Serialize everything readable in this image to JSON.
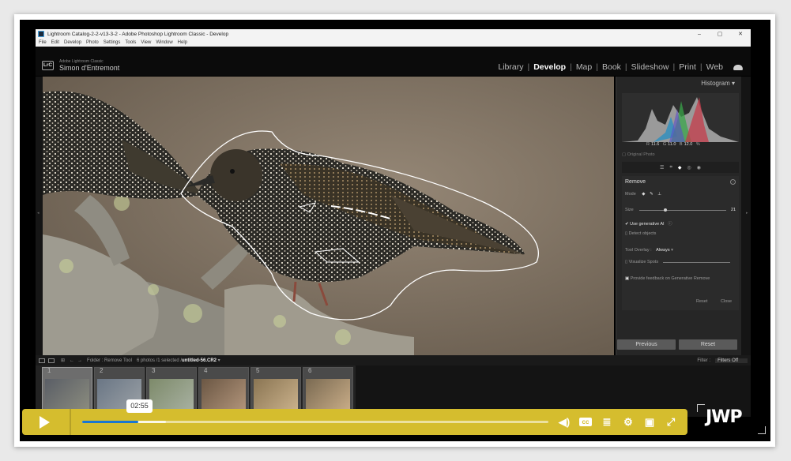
{
  "window": {
    "title": "Lightroom Catalog-2-2-v13-3-2 - Adobe Photoshop Lightroom Classic - Develop",
    "controls": [
      "–",
      "▢",
      "✕"
    ]
  },
  "menu": [
    "File",
    "Edit",
    "Develop",
    "Photo",
    "Settings",
    "Tools",
    "View",
    "Window",
    "Help"
  ],
  "identity": {
    "badge": "LrC",
    "app": "Adobe Lightroom Classic",
    "user": "Simon d'Entremont"
  },
  "modules": [
    {
      "label": "Library"
    },
    {
      "label": "Develop"
    },
    {
      "label": "Map"
    },
    {
      "label": "Book"
    },
    {
      "label": "Slideshow"
    },
    {
      "label": "Print"
    },
    {
      "label": "Web"
    }
  ],
  "histogram": {
    "title": "Histogram",
    "r_label": "R",
    "r_value": "11.6",
    "g_label": "G",
    "g_value": "11.0",
    "b_label": "B",
    "b_value": "12.0",
    "unit": "%",
    "original_photo": "Original Photo"
  },
  "remove_panel": {
    "title": "Remove",
    "mode_label": "Mode",
    "size_label": "Size",
    "size_value": "21",
    "size_fraction": 0.28,
    "use_ai_label": "Use generative AI",
    "detect_label": "Detect objects",
    "overlay_label": "Tool Overlay :",
    "overlay_value": "Always",
    "visualize_label": "Visualize Spots",
    "feedback_label": "Provide feedback on Generative Remove",
    "reset_label": "Reset",
    "close_label": "Close"
  },
  "panel_buttons": {
    "previous": "Previous",
    "reset": "Reset"
  },
  "filmstrip_bar": {
    "folder": "Folder : Remove Tool",
    "count": "6 photos /1 selected /",
    "filename": "untitled-56.CR2",
    "filter_label": "Filter :",
    "filter_value": "Filters Off"
  },
  "thumbnails": [
    {
      "num": "1",
      "colors": [
        "#5a5e66",
        "#8a8b7e"
      ]
    },
    {
      "num": "2",
      "colors": [
        "#6a7685",
        "#9aa0a5"
      ]
    },
    {
      "num": "3",
      "colors": [
        "#7d8a6a",
        "#a7b0a0"
      ]
    },
    {
      "num": "4",
      "colors": [
        "#6b5744",
        "#b09379"
      ]
    },
    {
      "num": "5",
      "colors": [
        "#8a7553",
        "#c9b08a"
      ]
    },
    {
      "num": "6",
      "colors": [
        "#7a6a52",
        "#c7ab86"
      ]
    }
  ],
  "player": {
    "time": "02:55",
    "progress": 0.12,
    "buffered": 0.18,
    "logo": "JWP",
    "accent": "#d5bd2e",
    "icons": [
      "volume-icon",
      "captions-icon",
      "playlist-icon",
      "settings-icon",
      "pip-icon",
      "fullscreen-icon"
    ]
  }
}
